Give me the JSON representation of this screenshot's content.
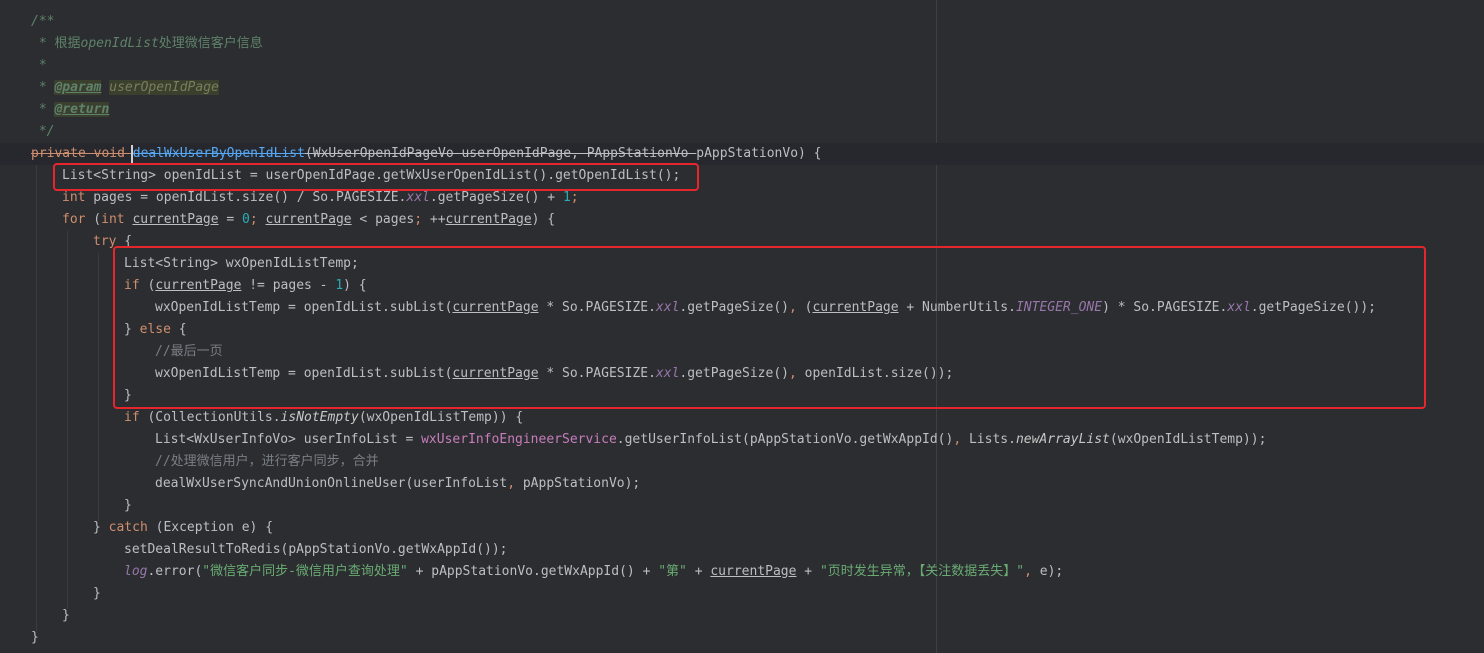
{
  "editor": {
    "language": "Java",
    "indent_unit": "    ",
    "lines": [
      {
        "indent": 0,
        "tokens": [
          {
            "t": "/**",
            "c": "doc"
          }
        ]
      },
      {
        "indent": 0,
        "tokens": [
          {
            "t": " * ",
            "c": "doc"
          },
          {
            "t": "根据",
            "c": "doc-cn"
          },
          {
            "t": "openIdList",
            "c": "doc"
          },
          {
            "t": "处理微信客户信息",
            "c": "doc-cn"
          }
        ]
      },
      {
        "indent": 0,
        "tokens": [
          {
            "t": " *",
            "c": "doc"
          }
        ]
      },
      {
        "indent": 0,
        "tokens": [
          {
            "t": " * ",
            "c": "doc"
          },
          {
            "t": "@param",
            "c": "tag"
          },
          {
            "t": " ",
            "c": "doc"
          },
          {
            "t": "userOpenIdPage",
            "c": "param"
          }
        ]
      },
      {
        "indent": 0,
        "tokens": [
          {
            "t": " * ",
            "c": "doc"
          },
          {
            "t": "@return",
            "c": "tag"
          }
        ]
      },
      {
        "indent": 0,
        "tokens": [
          {
            "t": " */",
            "c": "doc"
          }
        ]
      },
      {
        "indent": 0,
        "current": true,
        "tokens": [
          {
            "t": "private void ",
            "c": "strike-kw"
          },
          {
            "t": "dealWxUserByOpenIdList",
            "c": "strike-fn"
          },
          {
            "t": "(WxUserOpenIdPageVo userOpenIdPage, PAppStationVo ",
            "c": "strike"
          },
          {
            "t": "pAppStationVo) {",
            "c": "plain"
          }
        ]
      },
      {
        "indent": 1,
        "tokens": [
          {
            "t": "List<String> openIdList = userOpenIdPage.getWxUserOpenIdList().getOpenIdList();",
            "c": "plain"
          }
        ]
      },
      {
        "indent": 1,
        "tokens": [
          {
            "t": "int",
            "c": "kw"
          },
          {
            "t": " pages = openIdList.size() / So.PAGESIZE.",
            "c": "plain"
          },
          {
            "t": "xxl",
            "c": "field"
          },
          {
            "t": ".getPageSize() + ",
            "c": "plain"
          },
          {
            "t": "1",
            "c": "num"
          },
          {
            "t": ";",
            "c": "kw"
          }
        ]
      },
      {
        "indent": 1,
        "tokens": [
          {
            "t": "for",
            "c": "kw"
          },
          {
            "t": " (",
            "c": "plain"
          },
          {
            "t": "int",
            "c": "kw"
          },
          {
            "t": " ",
            "c": "plain"
          },
          {
            "t": "currentPage",
            "c": "local-u"
          },
          {
            "t": " = ",
            "c": "plain"
          },
          {
            "t": "0",
            "c": "num"
          },
          {
            "t": "; ",
            "c": "kw"
          },
          {
            "t": "currentPage",
            "c": "local-u"
          },
          {
            "t": " < pages",
            "c": "plain"
          },
          {
            "t": "; ",
            "c": "kw"
          },
          {
            "t": "++",
            "c": "plain"
          },
          {
            "t": "currentPage",
            "c": "local-u"
          },
          {
            "t": ") {",
            "c": "plain"
          }
        ]
      },
      {
        "indent": 2,
        "tokens": [
          {
            "t": "try",
            "c": "kw"
          },
          {
            "t": " {",
            "c": "plain"
          }
        ]
      },
      {
        "indent": 3,
        "tokens": [
          {
            "t": "List<String> wxOpenIdListTemp;",
            "c": "plain"
          }
        ]
      },
      {
        "indent": 3,
        "tokens": [
          {
            "t": "if",
            "c": "kw"
          },
          {
            "t": " (",
            "c": "plain"
          },
          {
            "t": "currentPage",
            "c": "local-u"
          },
          {
            "t": " != pages - ",
            "c": "plain"
          },
          {
            "t": "1",
            "c": "num"
          },
          {
            "t": ") {",
            "c": "plain"
          }
        ]
      },
      {
        "indent": 4,
        "tokens": [
          {
            "t": "wxOpenIdListTemp = openIdList.subList(",
            "c": "plain"
          },
          {
            "t": "currentPage",
            "c": "local-u"
          },
          {
            "t": " * So.PAGESIZE.",
            "c": "plain"
          },
          {
            "t": "xxl",
            "c": "field"
          },
          {
            "t": ".getPageSize()",
            "c": "plain"
          },
          {
            "t": ", ",
            "c": "kw"
          },
          {
            "t": "(",
            "c": "plain"
          },
          {
            "t": "currentPage",
            "c": "local-u"
          },
          {
            "t": " + NumberUtils.",
            "c": "plain"
          },
          {
            "t": "INTEGER_ONE",
            "c": "field"
          },
          {
            "t": ") * So.PAGESIZE.",
            "c": "plain"
          },
          {
            "t": "xxl",
            "c": "field"
          },
          {
            "t": ".getPageSize());",
            "c": "plain"
          }
        ]
      },
      {
        "indent": 3,
        "tokens": [
          {
            "t": "} ",
            "c": "plain"
          },
          {
            "t": "else",
            "c": "kw"
          },
          {
            "t": " {",
            "c": "plain"
          }
        ]
      },
      {
        "indent": 4,
        "tokens": [
          {
            "t": "//最后一页",
            "c": "comment"
          }
        ]
      },
      {
        "indent": 4,
        "tokens": [
          {
            "t": "wxOpenIdListTemp = openIdList.subList(",
            "c": "plain"
          },
          {
            "t": "currentPage",
            "c": "local-u"
          },
          {
            "t": " * So.PAGESIZE.",
            "c": "plain"
          },
          {
            "t": "xxl",
            "c": "field"
          },
          {
            "t": ".getPageSize()",
            "c": "plain"
          },
          {
            "t": ", ",
            "c": "kw"
          },
          {
            "t": "openIdList.size());",
            "c": "plain"
          }
        ]
      },
      {
        "indent": 3,
        "tokens": [
          {
            "t": "}",
            "c": "plain"
          }
        ]
      },
      {
        "indent": 3,
        "tokens": [
          {
            "t": "if",
            "c": "kw"
          },
          {
            "t": " (CollectionUtils.",
            "c": "plain"
          },
          {
            "t": "isNotEmpty",
            "c": "static"
          },
          {
            "t": "(wxOpenIdListTemp)) {",
            "c": "plain"
          }
        ]
      },
      {
        "indent": 4,
        "tokens": [
          {
            "t": "List<WxUserInfoVo> userInfoList = ",
            "c": "plain"
          },
          {
            "t": "wxUserInfoEngineerService",
            "c": "svc"
          },
          {
            "t": ".getUserInfoList(pAppStationVo.getWxAppId()",
            "c": "plain"
          },
          {
            "t": ", ",
            "c": "kw"
          },
          {
            "t": "Lists.",
            "c": "plain"
          },
          {
            "t": "newArrayList",
            "c": "static"
          },
          {
            "t": "(wxOpenIdListTemp));",
            "c": "plain"
          }
        ]
      },
      {
        "indent": 4,
        "tokens": [
          {
            "t": "//处理微信用户，进行客户同步，合并",
            "c": "comment"
          }
        ]
      },
      {
        "indent": 4,
        "tokens": [
          {
            "t": "dealWxUserSyncAndUnionOnlineUser(userInfoList",
            "c": "plain"
          },
          {
            "t": ", ",
            "c": "kw"
          },
          {
            "t": "pAppStationVo);",
            "c": "plain"
          }
        ]
      },
      {
        "indent": 3,
        "tokens": [
          {
            "t": "}",
            "c": "plain"
          }
        ]
      },
      {
        "indent": 2,
        "tokens": [
          {
            "t": "} ",
            "c": "plain"
          },
          {
            "t": "catch",
            "c": "kw"
          },
          {
            "t": " (Exception e) {",
            "c": "plain"
          }
        ]
      },
      {
        "indent": 3,
        "tokens": [
          {
            "t": "setDealResultToRedis(pAppStationVo.getWxAppId());",
            "c": "plain"
          }
        ]
      },
      {
        "indent": 3,
        "tokens": [
          {
            "t": "log",
            "c": "log"
          },
          {
            "t": ".error(",
            "c": "plain"
          },
          {
            "t": "\"微信客户同步-微信用户查询处理\"",
            "c": "str"
          },
          {
            "t": " + pAppStationVo.getWxAppId() + ",
            "c": "plain"
          },
          {
            "t": "\"第\"",
            "c": "str"
          },
          {
            "t": " + ",
            "c": "plain"
          },
          {
            "t": "currentPage",
            "c": "local-u"
          },
          {
            "t": " + ",
            "c": "plain"
          },
          {
            "t": "\"页时发生异常，【关注数据丢失】\"",
            "c": "str"
          },
          {
            "t": ", ",
            "c": "kw"
          },
          {
            "t": "e);",
            "c": "plain"
          }
        ]
      },
      {
        "indent": 2,
        "tokens": [
          {
            "t": "}",
            "c": "plain"
          }
        ]
      },
      {
        "indent": 1,
        "tokens": [
          {
            "t": "}",
            "c": "plain"
          }
        ]
      },
      {
        "indent": 0,
        "tokens": [
          {
            "t": "}",
            "c": "plain"
          }
        ]
      }
    ]
  },
  "gutter": {
    "intention_icon": "lightbulb-icon"
  },
  "annotations": [
    {
      "name": "highlight-box-openidlist",
      "color": "#e5262c"
    },
    {
      "name": "highlight-box-sublist",
      "color": "#e5262c"
    }
  ]
}
